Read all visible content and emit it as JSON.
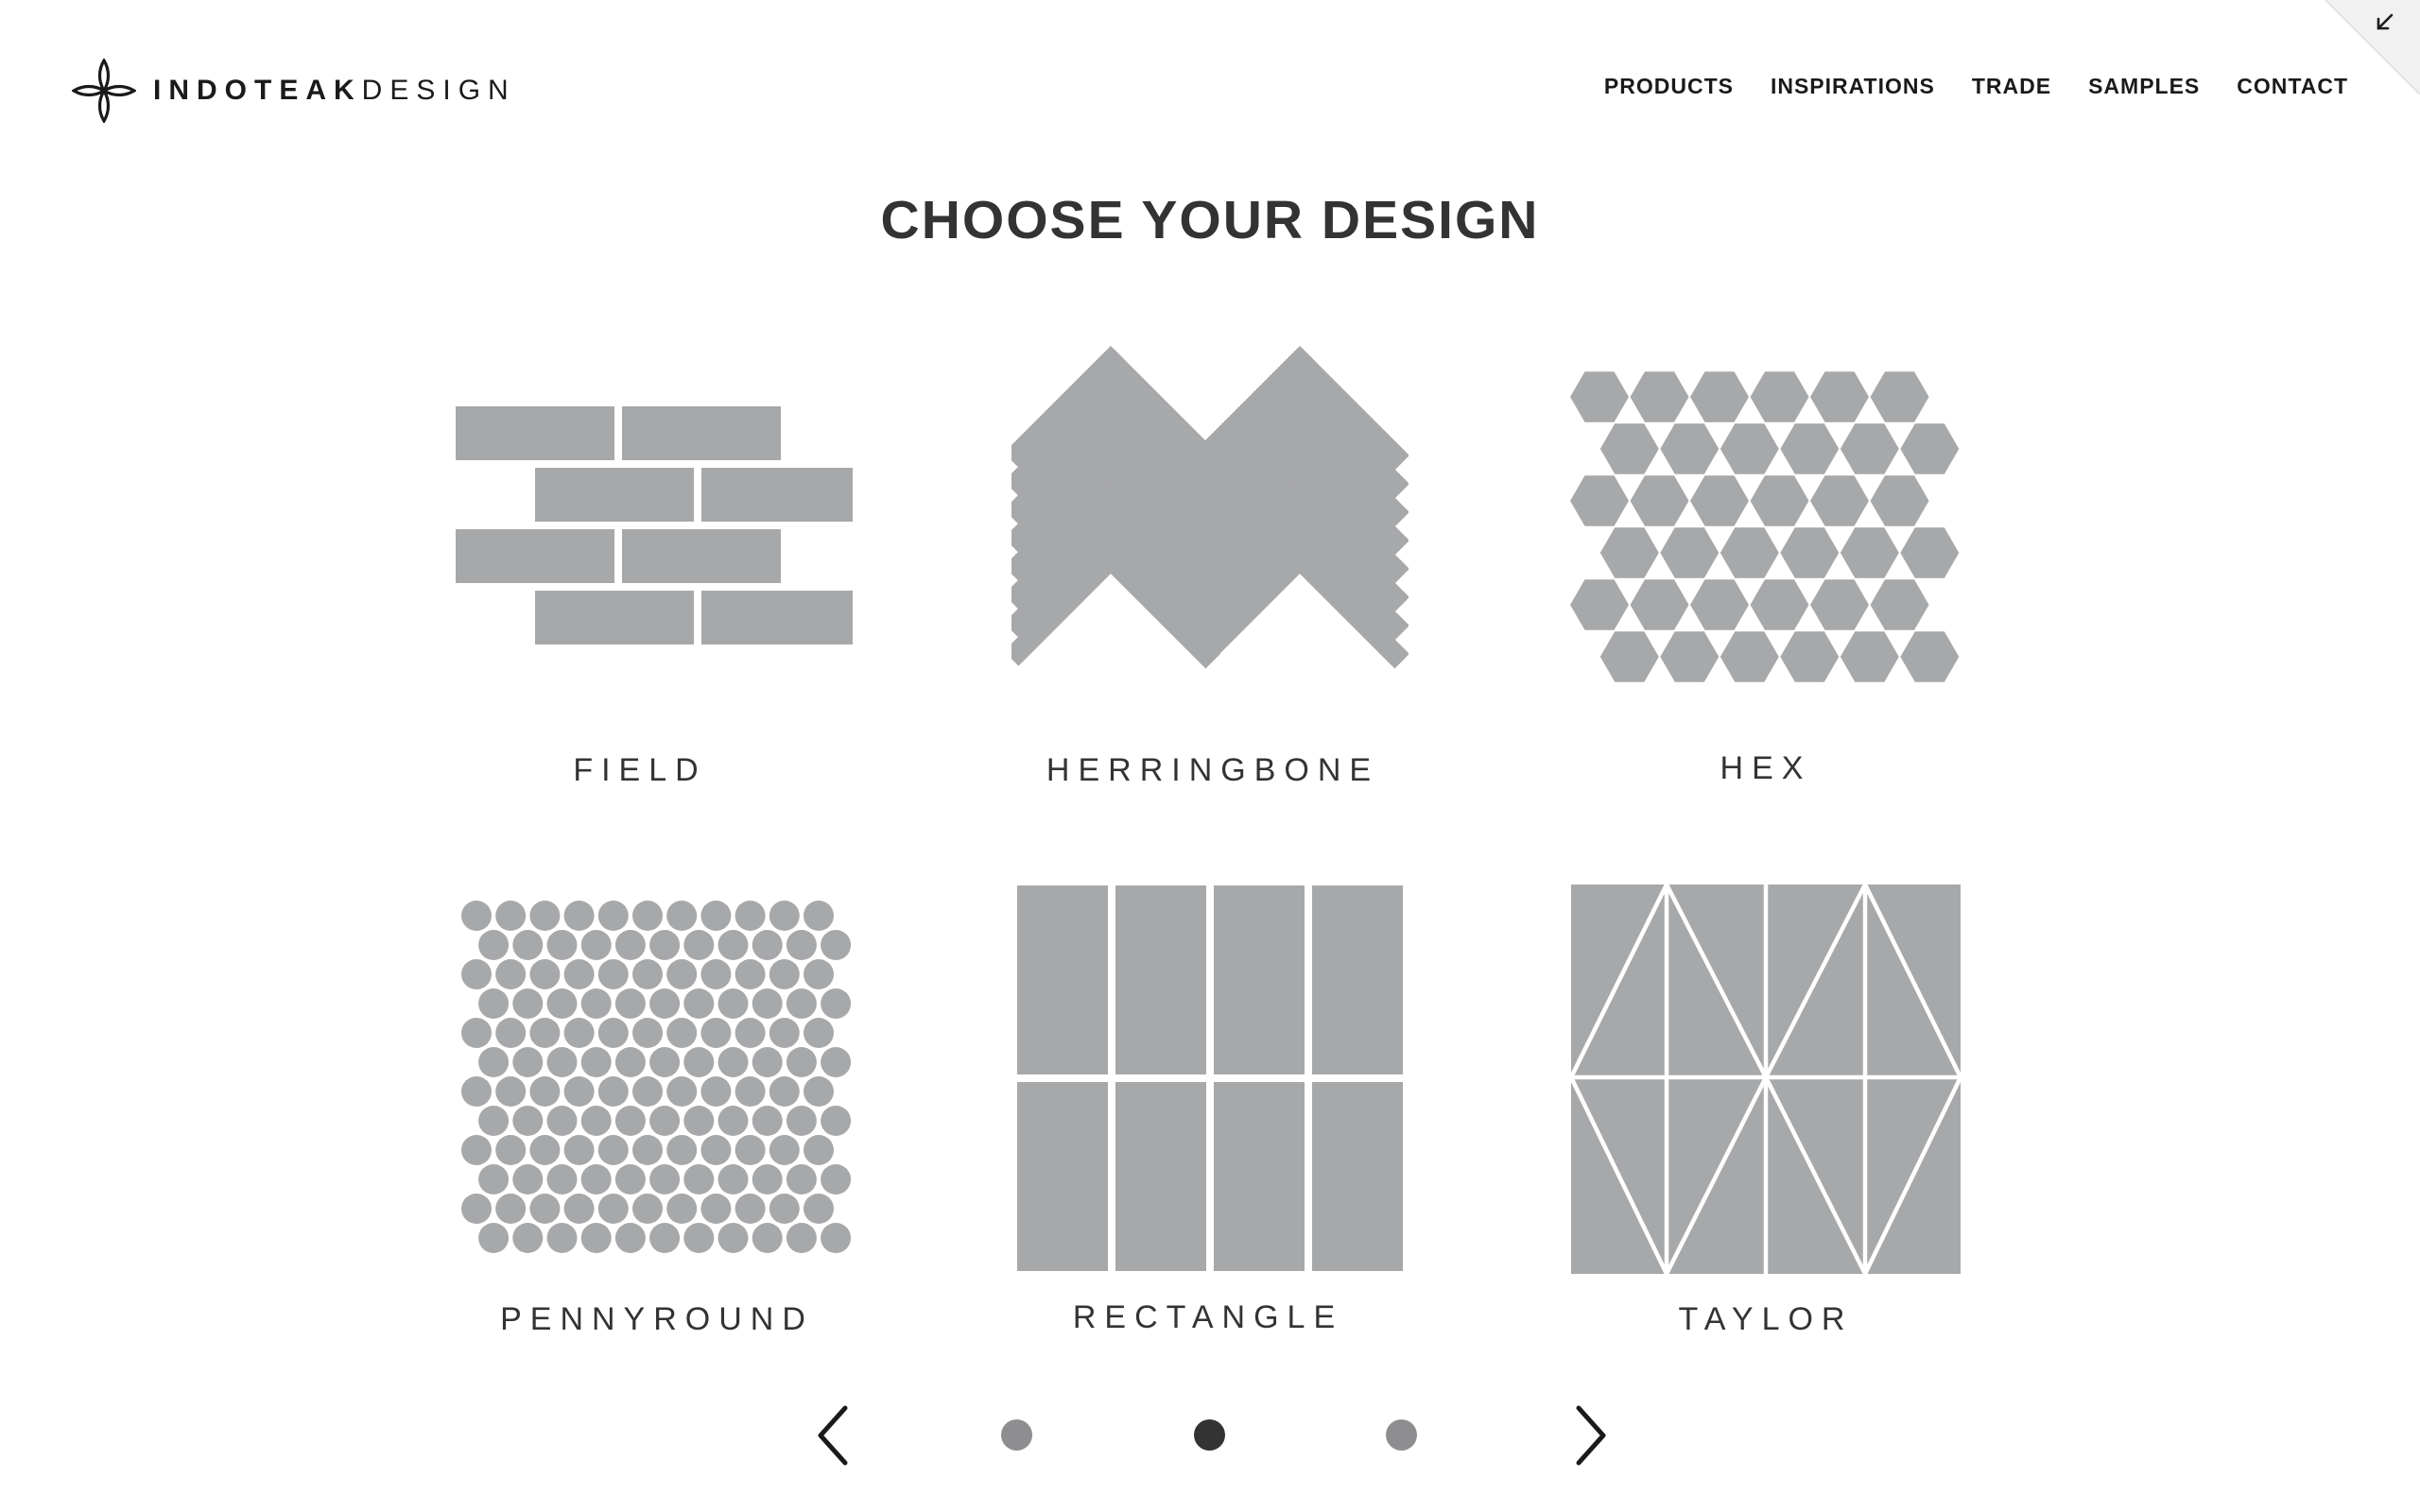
{
  "brand": {
    "name_bold": "INDOTEAK",
    "name_light": "DESIGN",
    "logo_icon": "quatrefoil-logo-icon"
  },
  "nav": {
    "items": [
      {
        "label": "PRODUCTS"
      },
      {
        "label": "INSPIRATIONS"
      },
      {
        "label": "TRADE"
      },
      {
        "label": "SAMPLES"
      },
      {
        "label": "CONTACT"
      }
    ]
  },
  "corner_icon": "collapse-arrow-icon",
  "page": {
    "title": "CHOOSE YOUR DESIGN"
  },
  "designs": [
    {
      "label": "FIELD",
      "icon": "field-pattern-icon"
    },
    {
      "label": "HERRINGBONE",
      "icon": "herringbone-pattern-icon"
    },
    {
      "label": "HEX",
      "icon": "hex-pattern-icon"
    },
    {
      "label": "PENNYROUND",
      "icon": "pennyround-pattern-icon"
    },
    {
      "label": "RECTANGLE",
      "icon": "rectangle-pattern-icon"
    },
    {
      "label": "TAYLOR",
      "icon": "taylor-pattern-icon"
    }
  ],
  "pager": {
    "prev_icon": "chevron-left-icon",
    "next_icon": "chevron-right-icon",
    "page_count": 3,
    "active_page": 2
  },
  "colors": {
    "tile": "#a7a8aa",
    "text": "#1a1a1a",
    "heading": "#333333",
    "dot_active": "#333333",
    "dot_inactive": "#8e8e90"
  }
}
